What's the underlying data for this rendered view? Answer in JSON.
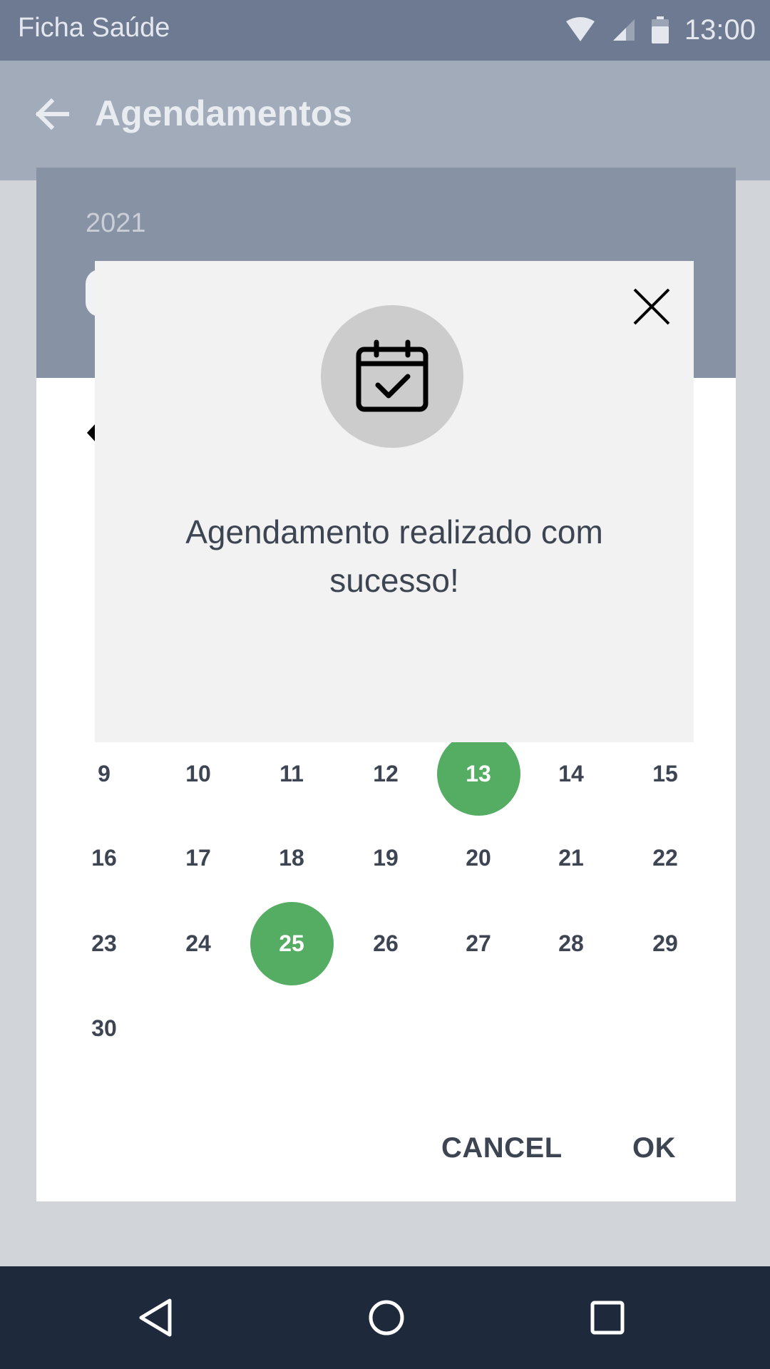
{
  "status_bar": {
    "app_name": "Ficha Saúde",
    "time": "13:00"
  },
  "app_bar": {
    "title": "Agendamentos"
  },
  "date_picker": {
    "year": "2021",
    "rows": [
      [
        "9",
        "10",
        "11",
        "12",
        "13",
        "14",
        "15"
      ],
      [
        "16",
        "17",
        "18",
        "19",
        "20",
        "21",
        "22"
      ],
      [
        "23",
        "24",
        "25",
        "26",
        "27",
        "28",
        "29"
      ],
      [
        "30"
      ]
    ],
    "highlighted_days": [
      "13",
      "25"
    ],
    "cancel_label": "CANCEL",
    "ok_label": "OK"
  },
  "modal": {
    "message": "Agendamento realizado com sucesso!"
  },
  "colors": {
    "highlight": "#55ad63",
    "status_bar": "#6d7a91",
    "app_bar": "#a1abb9",
    "picker_header": "#8792a5",
    "nav_bar": "#1e2a3c",
    "modal_bg": "#f2f2f2"
  },
  "icons": {
    "back": "arrow-left-icon",
    "close": "close-icon",
    "modal": "calendar-check-icon",
    "nav_back": "triangle-back-icon",
    "nav_home": "circle-home-icon",
    "nav_recents": "square-recents-icon"
  }
}
